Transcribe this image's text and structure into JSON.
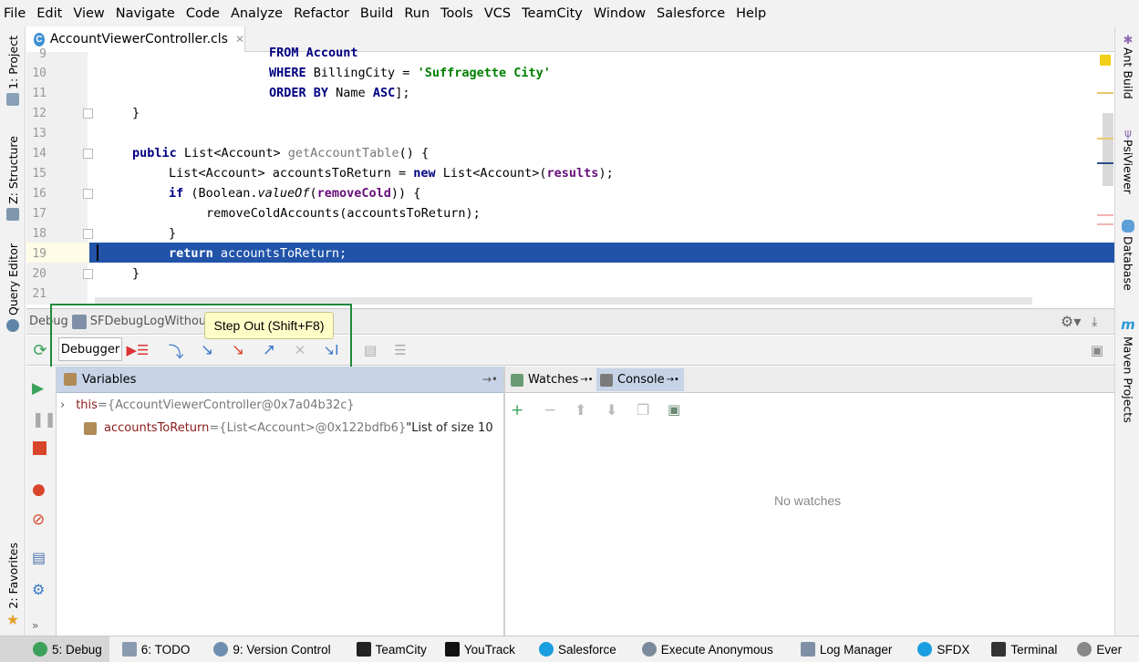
{
  "menu": [
    "File",
    "Edit",
    "View",
    "Navigate",
    "Code",
    "Analyze",
    "Refactor",
    "Build",
    "Run",
    "Tools",
    "VCS",
    "TeamCity",
    "Window",
    "Salesforce",
    "Help"
  ],
  "left_strip": {
    "project": "1: Project",
    "structure": "Z: Structure",
    "query_editor": "Query Editor",
    "favorites": "2: Favorites"
  },
  "right_strip": {
    "ant_build": "Ant Build",
    "psiviewer": "PsiViewer",
    "database": "Database",
    "maven": "Maven Projects"
  },
  "editor": {
    "tab_label": "AccountViewerController.cls",
    "tab_icon_letter": "C",
    "lines": [
      {
        "n": "9"
      },
      {
        "n": "10"
      },
      {
        "n": "11"
      },
      {
        "n": "12"
      },
      {
        "n": "13"
      },
      {
        "n": "14"
      },
      {
        "n": "15"
      },
      {
        "n": "16"
      },
      {
        "n": "17"
      },
      {
        "n": "18"
      },
      {
        "n": "19"
      },
      {
        "n": "20"
      },
      {
        "n": "21"
      }
    ],
    "code": {
      "l9": "FROM Account",
      "l10_kw": "WHERE",
      "l10_a": " BillingCity = ",
      "l10_str": "'Suffragette City'",
      "l11_kw1": "ORDER BY",
      "l11_a": " Name ",
      "l11_kw2": "ASC",
      "l11_b": "];",
      "l12": "}",
      "l14_kw": "public",
      "l14_a": " List<Account> ",
      "l14_fn": "getAccountTable",
      "l14_b": "() {",
      "l15_a": "List<Account> accountsToReturn = ",
      "l15_kw": "new",
      "l15_b": " List<Account>(",
      "l15_fld": "results",
      "l15_c": ");",
      "l16_kw": "if",
      "l16_a": " (Boolean.",
      "l16_it": "valueOf",
      "l16_b": "(",
      "l16_fld": "removeCold",
      "l16_c": ")) {",
      "l17": "removeColdAccounts(accountsToReturn);",
      "l18": "}",
      "l19_kw": "return",
      "l19_a": " accountsToReturn;",
      "l20": "}"
    }
  },
  "debug": {
    "label": "Debug",
    "config": "SFDebugLogWithoutE",
    "debugger_tab": "Debugger",
    "tooltip": "Step Out (Shift+F8)",
    "variables_header": "Variables",
    "watches_tab": "Watches",
    "console_tab": "Console",
    "vars": [
      {
        "name": "this",
        "eq": " = ",
        "value": "{AccountViewerController@0x7a04b32c}"
      },
      {
        "name": "accountsToReturn",
        "eq": " = ",
        "value": "{List<Account>@0x122bdfb6}",
        "extra": " \"List of size 10"
      }
    ],
    "no_watches": "No watches"
  },
  "bottom_tabs": [
    {
      "label": "5: Debug"
    },
    {
      "label": "6: TODO"
    },
    {
      "label": "9: Version Control"
    },
    {
      "label": "TeamCity"
    },
    {
      "label": "YouTrack"
    },
    {
      "label": "Salesforce"
    },
    {
      "label": "Execute Anonymous"
    },
    {
      "label": "Log Manager"
    },
    {
      "label": "SFDX"
    },
    {
      "label": "Terminal"
    },
    {
      "label": "Ever"
    }
  ],
  "colors": {
    "selection": "#2154a9",
    "accent_green": "#1e8a3a",
    "keyword": "#000080",
    "string": "#008000",
    "field": "#660e7a"
  }
}
